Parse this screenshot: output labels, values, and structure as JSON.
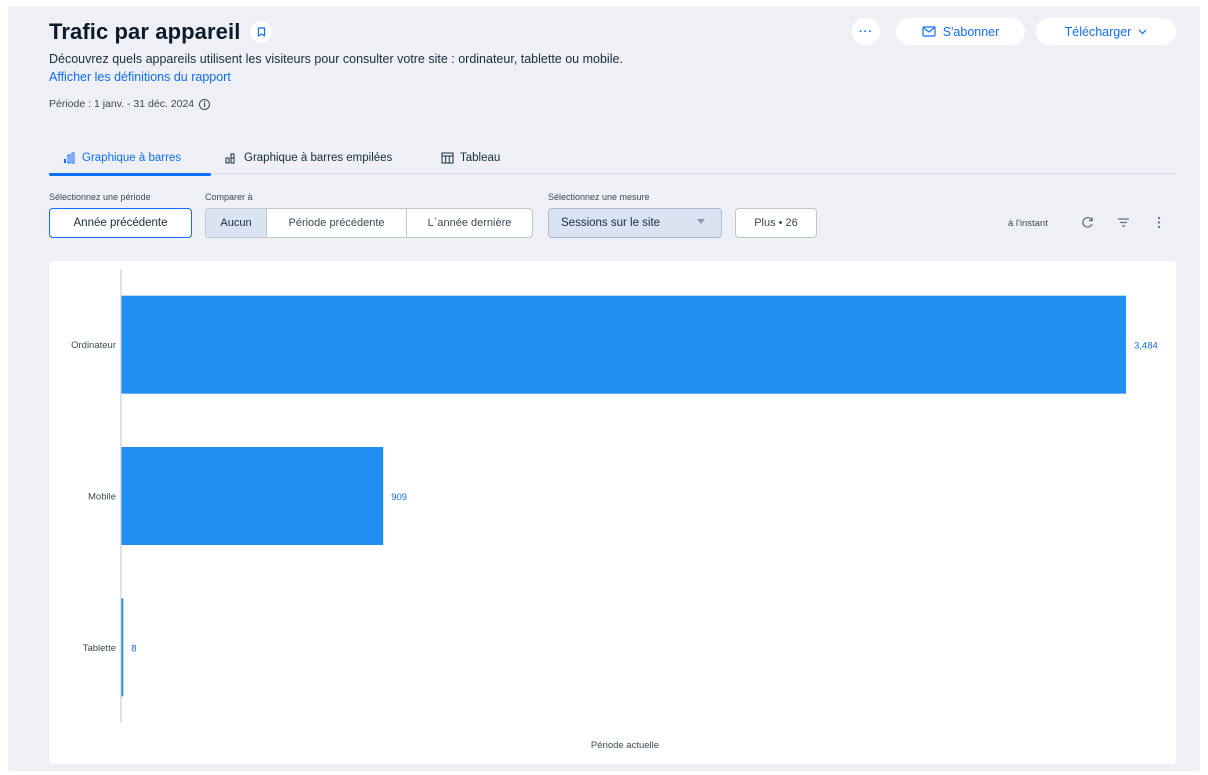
{
  "header": {
    "title": "Trafic par appareil",
    "description": "Découvrez quels appareils utilisent les visiteurs pour consulter votre site : ordinateur, tablette ou mobile.",
    "definitions_link": "Afficher les définitions du rapport",
    "period": "Période : 1 janv. - 31 déc. 2024",
    "more_label": "···",
    "subscribe_label": "S'abonner",
    "download_label": "Télécharger"
  },
  "tabs": [
    {
      "label": "Graphique à barres",
      "icon": "bar-chart-icon",
      "active": true
    },
    {
      "label": "Graphique à barres empilées",
      "icon": "stacked-bar-icon",
      "active": false
    },
    {
      "label": "Tableau",
      "icon": "table-icon",
      "active": false
    }
  ],
  "controls": {
    "period_label": "Sélectionnez une période",
    "period_value": "Année précédente",
    "compare_label": "Comparer à",
    "compare_options": [
      "Aucun",
      "Période précédente",
      "L`année dernière"
    ],
    "compare_selected": "Aucun",
    "measure_label": "Sélectionnez une mesure",
    "measure_value": "Sessions sur le site",
    "plus_label": "Plus • 26",
    "status": "à l'instant"
  },
  "colors": {
    "accent": "#116dff",
    "bar": "#1f8ff0",
    "panel": "#eef0f5"
  },
  "chart_data": {
    "type": "bar",
    "orientation": "horizontal",
    "categories": [
      "Ordinateur",
      "Mobile",
      "Tablette"
    ],
    "values": [
      3484,
      909,
      8
    ],
    "value_labels": [
      "3,484",
      "909",
      "8"
    ],
    "xlabel": "Période actuelle",
    "ylabel": "",
    "xlim": [
      0,
      3484
    ],
    "grid": false,
    "legend": "none"
  }
}
